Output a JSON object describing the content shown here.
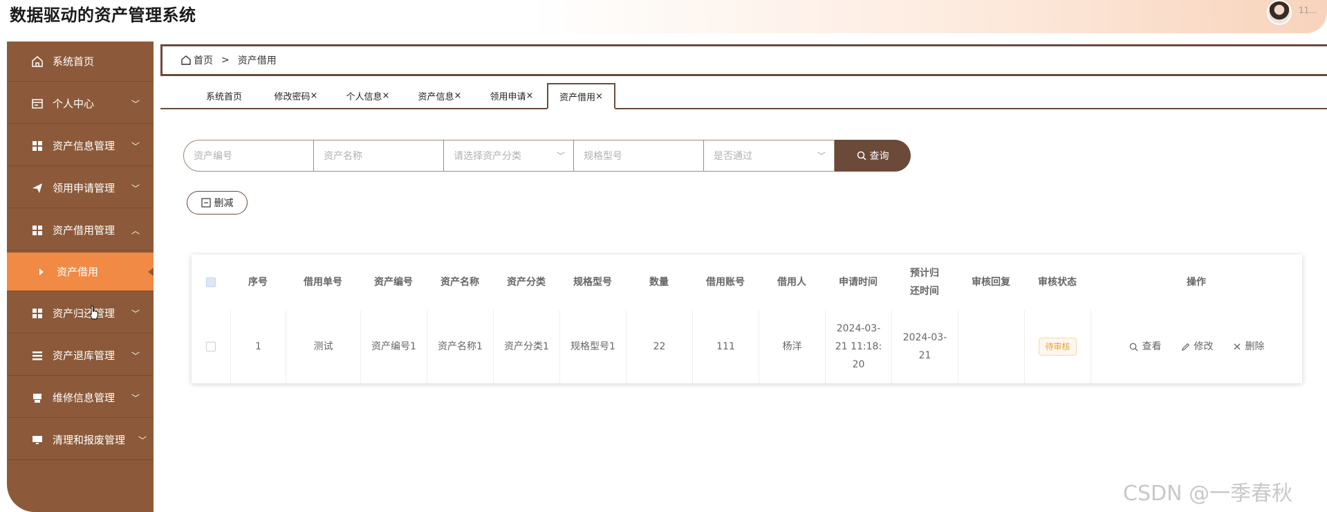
{
  "app": {
    "title": "数据驱动的资产管理系统",
    "user_name": "11..."
  },
  "sidebar": {
    "items": [
      {
        "label": "系统首页",
        "icon": "home-icon",
        "expanded": null
      },
      {
        "label": "个人中心",
        "icon": "id-card-icon",
        "expanded": false
      },
      {
        "label": "资产信息管理",
        "icon": "grid-icon",
        "expanded": false
      },
      {
        "label": "领用申请管理",
        "icon": "send-icon",
        "expanded": false
      },
      {
        "label": "资产借用管理",
        "icon": "grid-icon",
        "expanded": true
      },
      {
        "label": "资产借用",
        "icon": "caret-right-icon",
        "active": true
      },
      {
        "label": "资产归还管理",
        "icon": "grid-icon",
        "expanded": false
      },
      {
        "label": "资产退库管理",
        "icon": "list-icon",
        "expanded": false
      },
      {
        "label": "维修信息管理",
        "icon": "printer-icon",
        "expanded": false
      },
      {
        "label": "清理和报废管理",
        "icon": "monitor-icon",
        "expanded": false
      }
    ]
  },
  "breadcrumb": {
    "home": "首页",
    "separator": ">",
    "current": "资产借用"
  },
  "tabs": [
    {
      "label": "系统首页",
      "closable": false
    },
    {
      "label": "修改密码",
      "closable": true
    },
    {
      "label": "个人信息",
      "closable": true
    },
    {
      "label": "资产信息",
      "closable": true
    },
    {
      "label": "领用申请",
      "closable": true
    },
    {
      "label": "资产借用",
      "closable": true,
      "active": true
    }
  ],
  "tab_close": "×",
  "search": {
    "asset_no_placeholder": "资产编号",
    "asset_name_placeholder": "资产名称",
    "category_placeholder": "请选择资产分类",
    "spec_placeholder": "规格型号",
    "passed_placeholder": "是否通过",
    "query_label": "查询"
  },
  "actions": {
    "delete_label": "删减"
  },
  "table": {
    "columns": [
      "序号",
      "借用单号",
      "资产编号",
      "资产名称",
      "资产分类",
      "规格型号",
      "数量",
      "借用账号",
      "借用人",
      "申请时间",
      "预计归还时间",
      "审核回复",
      "审核状态",
      "操作"
    ],
    "rows": [
      {
        "index": "1",
        "borrow_no": "测试",
        "asset_no": "资产编号1",
        "asset_name": "资产名称1",
        "category": "资产分类1",
        "spec": "规格型号1",
        "quantity": "22",
        "account": "111",
        "borrower": "杨洋",
        "apply_time": "2024-03-21 11:18:20",
        "return_time": "2024-03-21",
        "reply": "",
        "status": "待审核",
        "ops": {
          "view": "查看",
          "edit": "修改",
          "delete": "删除"
        }
      }
    ]
  },
  "watermark": "CSDN @一季春秋",
  "colors": {
    "sidebar": "#8c5a3a",
    "active": "#f08a45",
    "accent": "#6b4a3a",
    "badge": "#e6a23c"
  }
}
